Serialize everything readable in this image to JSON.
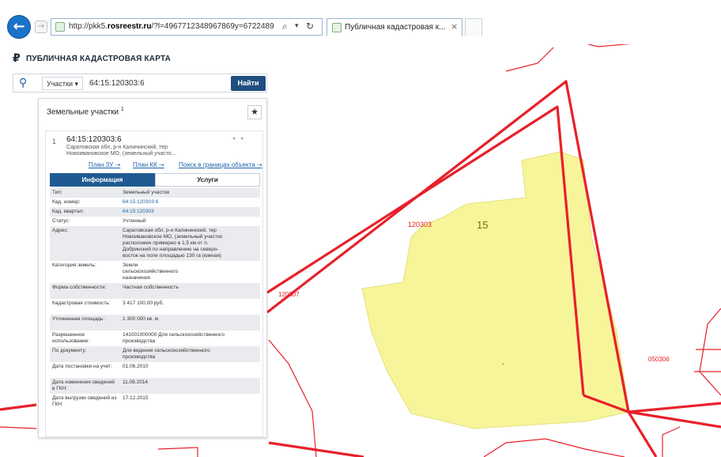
{
  "browser": {
    "url_prefix": "http://pkk5.",
    "url_domain": "rosreestr.ru",
    "url_rest": "/?l=4967712348967869y=6722489",
    "tab_title": "Публичная кадастровая к...",
    "tab_close": "×"
  },
  "app": {
    "title": "ПУБЛИЧНАЯ КАДАСТРОВАЯ КАРТА",
    "logo": "₽"
  },
  "search": {
    "type": "Участки",
    "query": "64:15:120303:6",
    "button": "Найти"
  },
  "panel": {
    "title": "Земельные участки",
    "title_mark": "1",
    "star": "★"
  },
  "parcel": {
    "index": "1",
    "cad_number": "64:15:120303:6",
    "address_line1": "Саратовская обл, р-н Калининский, тер",
    "address_line2": "Новоивановское МО, (земельный участо...",
    "link_3d": "План ЗУ ⇢",
    "link_ok": "План КК ⇢",
    "link_search": "Поиск в границах объекта ⇢",
    "tab_info": "Информация",
    "tab_services": "Услуги"
  },
  "attributes": [
    {
      "key": "Тип:",
      "value": [
        "Земельный участок"
      ],
      "link": false
    },
    {
      "key": "Кад. номер:",
      "value": [
        "64:15:120303:6"
      ],
      "link": true
    },
    {
      "key": "Кад. квартал:",
      "value": [
        "64:15:120303"
      ],
      "link": true
    },
    {
      "key": "Статус:",
      "value": [
        "Учтенный"
      ],
      "link": false
    },
    {
      "key": "Адрес:",
      "value": [
        "Саратовская обл, р-н Калининский, тер",
        "Новоивановское МО, (земельный участок",
        "расположен примерно в 1,5 км от п.",
        "Добринский по направлению на северо-",
        "восток на поле площадью 130 га (южная)"
      ],
      "link": false
    },
    {
      "key": "Категория земель:",
      "value": [
        "Земли",
        "сельскохозяйственного",
        "назначения"
      ],
      "link": false
    },
    {
      "key": "Форма собственности:",
      "value": [
        "Частная собственность"
      ],
      "link": false
    },
    {
      "key": "Кадастровая стоимость:",
      "value": [
        "3 417 100,00 руб."
      ],
      "link": false
    },
    {
      "key": "Уточненная площадь:",
      "value": [
        "1 300 000 кв. м"
      ],
      "link": false
    },
    {
      "key": "Разрешенное использование:",
      "value": [
        "141001000000 Для сельскохозяйственного",
        "производства"
      ],
      "link": false
    },
    {
      "key": "По документу:",
      "value": [
        "Для ведения сельскохозяйственного",
        "производства"
      ],
      "link": false
    },
    {
      "key": "Дата постановки на учет:",
      "value": [
        "01.06.2010"
      ],
      "link": false
    },
    {
      "key": "Дата изменения сведений в ГКН:",
      "value": [
        "11.08.2014"
      ],
      "link": false
    },
    {
      "key": "Дата выгрузки сведений из ГКН:",
      "value": [
        "17.12.2015"
      ],
      "link": false
    }
  ],
  "map": {
    "labels": {
      "quarter_main": "120303",
      "plot_number": "15",
      "quarter_left": "120307",
      "quarter_right": "050306",
      "dot_center": "•"
    },
    "colors": {
      "boundary": "#e8202a",
      "parcel_fill": "#f7f59a",
      "parcel_stroke": "#e6e07a"
    }
  }
}
